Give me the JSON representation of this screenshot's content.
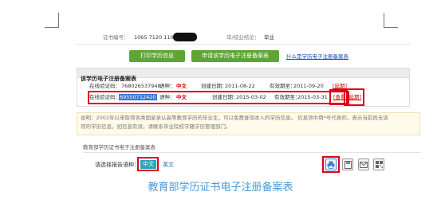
{
  "top": {
    "cert_no_label": "证书编号：",
    "cert_no_value": "1065 7120 1105",
    "conclusion_label": "毕/结业结论：",
    "conclusion_value": "毕业"
  },
  "buttons": {
    "print": "打印学历信息",
    "apply": "申请该学历电子注册备案表",
    "what_is": "什么是学历电子注册备案表"
  },
  "record_table": {
    "title": "该学历电子注册备案表",
    "rows": [
      {
        "code_label": "在线验证码：",
        "code": "768026537948",
        "lang_label": "语种：",
        "lang": "中文",
        "created_label": "创建日期：",
        "created": "2011-08-22",
        "valid_label": "有效期至：",
        "valid": "2011-09-20",
        "actions": [
          "[延期]"
        ]
      },
      {
        "code_label": "在线验证码：",
        "code": "69550712420",
        "lang_label": "语种：",
        "lang": "中文",
        "created_label": "创建日期：",
        "created": "2015-03-02",
        "valid_label": "有效期至：",
        "valid": "2015-03-31",
        "actions": [
          "[查看]",
          "[延期]"
        ]
      }
    ]
  },
  "note": {
    "line1": "说明：2002年以来取得各类国家承认高等教育学历的毕业生，可以免费查询本人的学历信息。 信息项中用*号代表的，表示当前尚无该",
    "line2": "项的学历信息。如信息有误，请联系毕业院校学籍学历管理部门。"
  },
  "section2": {
    "title": "教育部学历证书电子注册备案表",
    "lang_label": "请选择报告语种：",
    "lang_zh": "中文",
    "lang_en": "英文",
    "heading": "教育部学历证书电子注册备案表"
  },
  "colors": {
    "green": "#5fa534",
    "red": "#e1001a",
    "heading": "#4a9ad4",
    "link": "#1a4fb3"
  }
}
